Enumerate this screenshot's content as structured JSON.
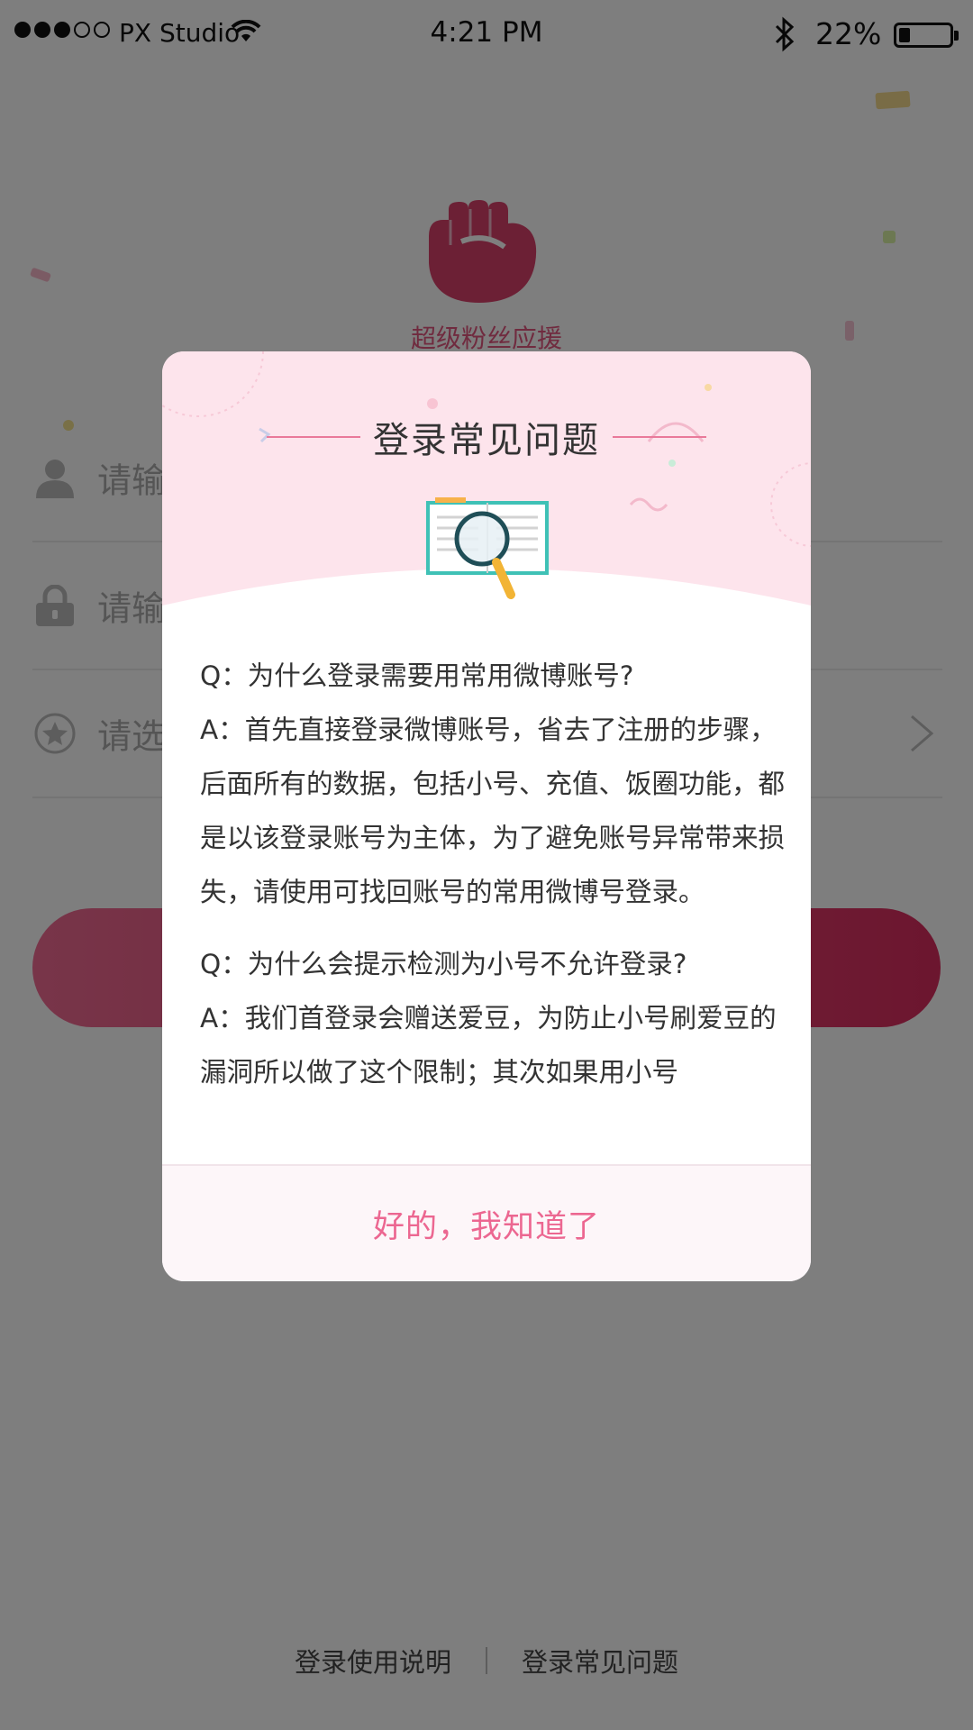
{
  "status_bar": {
    "carrier": "PX Studio",
    "time": "4:21 PM",
    "battery_percent": "22%",
    "battery_level": 0.22,
    "signal_full": 3,
    "signal_empty": 2
  },
  "app": {
    "name": "超级粉丝应援",
    "brand_color": "#e0577f"
  },
  "login_form": {
    "username_placeholder": "请输",
    "password_placeholder": "请输",
    "select_placeholder": "请选"
  },
  "bottom_links": {
    "instructions": "登录使用说明",
    "faq": "登录常见问题"
  },
  "dialog": {
    "title": "登录常见问题",
    "qa": [
      {
        "q": "Q：为什么登录需要用常用微博账号?",
        "a": "A：首先直接登录微博账号，省去了注册的步骤，后面所有的数据，包括小号、充值、饭圈功能，都是以该登录账号为主体，为了避免账号异常带来损失，请使用可找回账号的常用微博号登录。"
      },
      {
        "q": "Q：为什么会提示检测为小号不允许登录?",
        "a": "A：我们首登录会赠送爱豆，为防止小号刷爱豆的漏洞所以做了这个限制；其次如果用小号"
      }
    ],
    "confirm_button": "好的，我知道了",
    "accent_color": "#ec6791",
    "header_color": "#fde4ec"
  }
}
